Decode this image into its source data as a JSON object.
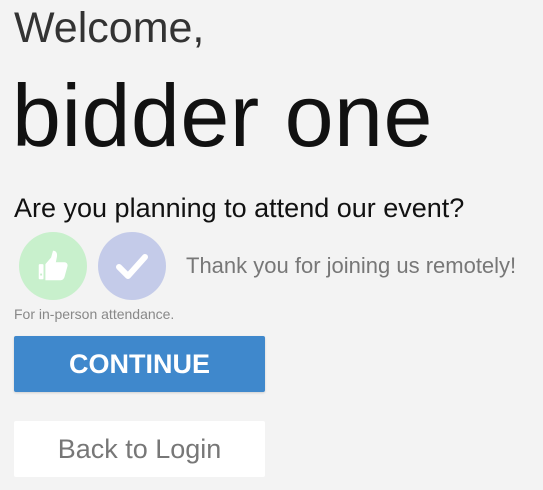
{
  "greeting": {
    "welcome": "Welcome,",
    "username": "bidder one"
  },
  "attendance": {
    "question": "Are you planning to attend our event?",
    "in_person_icon": "thumbs-up-icon",
    "remote_icon": "checkmark-icon",
    "remote_message": "Thank you for joining us remotely!",
    "in_person_hint": "For in-person attendance."
  },
  "actions": {
    "continue_label": "CONTINUE",
    "back_label": "Back to Login"
  },
  "colors": {
    "background": "#f3f3f3",
    "in_person_circle": "#c8f0cc",
    "remote_circle": "#c4cbe9",
    "primary_button": "#3f88cc",
    "secondary_button": "#ffffff"
  }
}
